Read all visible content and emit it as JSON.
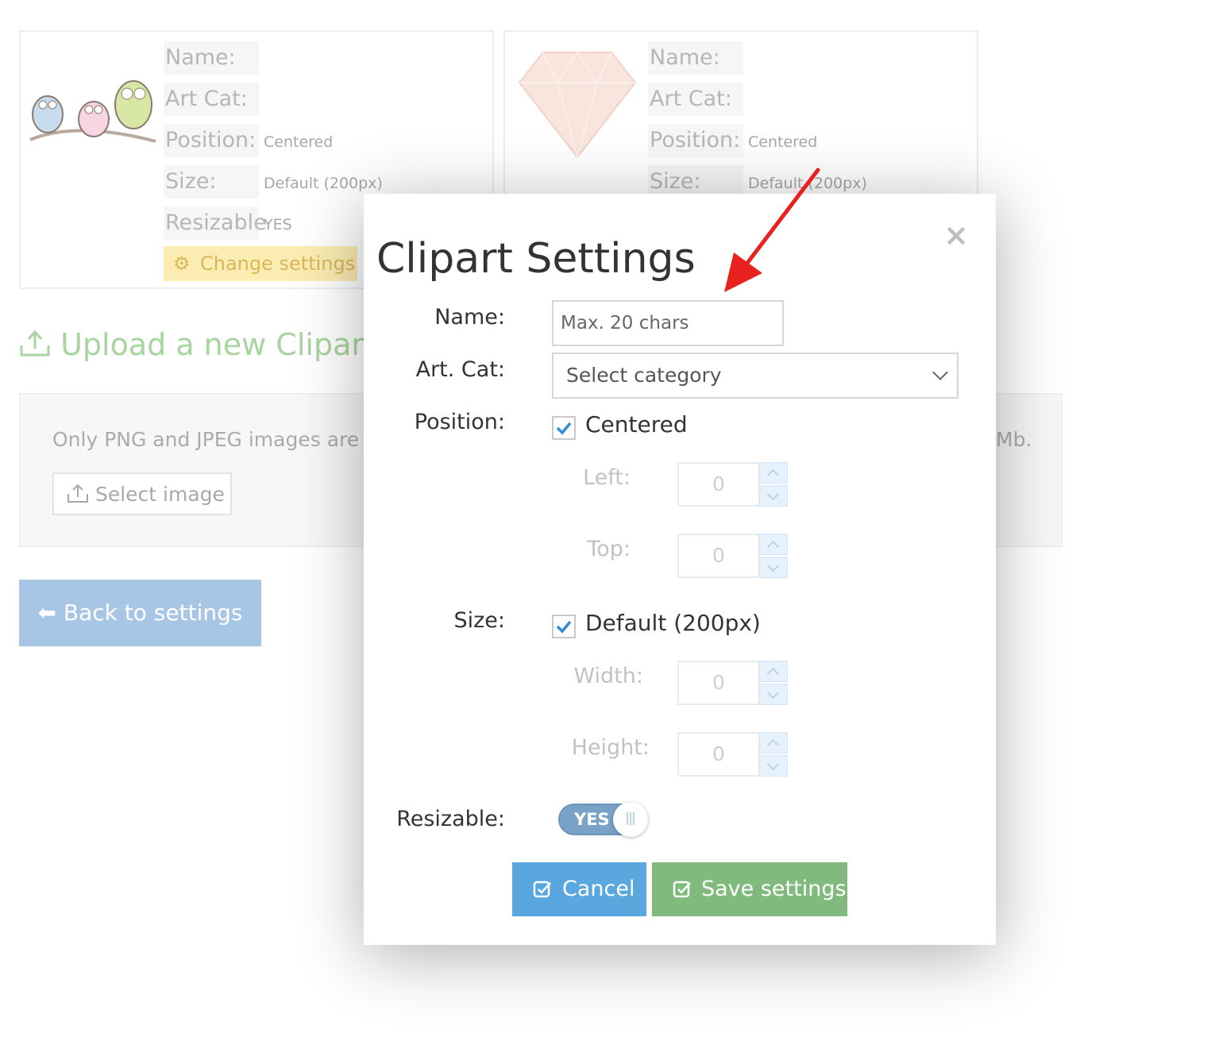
{
  "cards": [
    {
      "name_label": "Name:",
      "artcat_label": "Art Cat:",
      "position_label": "Position:",
      "position_value": "Centered",
      "size_label": "Size:",
      "size_value": "Default (200px)",
      "resizable_label": "Resizable",
      "resizable_value": "YES",
      "change_button": "Change settings"
    },
    {
      "name_label": "Name:",
      "artcat_label": "Art Cat:",
      "position_label": "Position:",
      "position_value": "Centered",
      "size_label": "Size:",
      "size_value": "Default (200px)"
    }
  ],
  "upload": {
    "title": "Upload a new Clipart",
    "info_text_visible": "Only PNG and JPEG images are a",
    "info_text_tail": "Mb.",
    "select_button": "Select image"
  },
  "back_button": "Back to settings",
  "modal": {
    "title": "Clipart Settings",
    "close_symbol": "×",
    "name_label": "Name:",
    "name_placeholder": "Max. 20 chars",
    "name_value": "",
    "artcat_label": "Art. Cat:",
    "artcat_selected": "Select category",
    "position_label": "Position:",
    "centered_checked": true,
    "centered_label": "Centered",
    "left_label": "Left:",
    "left_value": "0",
    "top_label": "Top:",
    "top_value": "0",
    "size_label": "Size:",
    "default_size_checked": true,
    "default_size_label": "Default (200px)",
    "width_label": "Width:",
    "width_value": "0",
    "height_label": "Height:",
    "height_value": "0",
    "resizable_label": "Resizable:",
    "resizable_toggle": "YES",
    "cancel_button": "Cancel",
    "save_button": "Save settings"
  },
  "colors": {
    "annotation_arrow": "#e8201e",
    "cancel_button": "#5aa7df",
    "save_button": "#80ba7c",
    "toggle_on": "#7aa2c6"
  },
  "icons": [
    "owls-clipart-image",
    "diamond-clipart-image",
    "gears-icon",
    "upload-icon",
    "arrow-left-icon",
    "close-icon",
    "checkmark-icon",
    "chevron-down-icon",
    "check-square-icon"
  ]
}
